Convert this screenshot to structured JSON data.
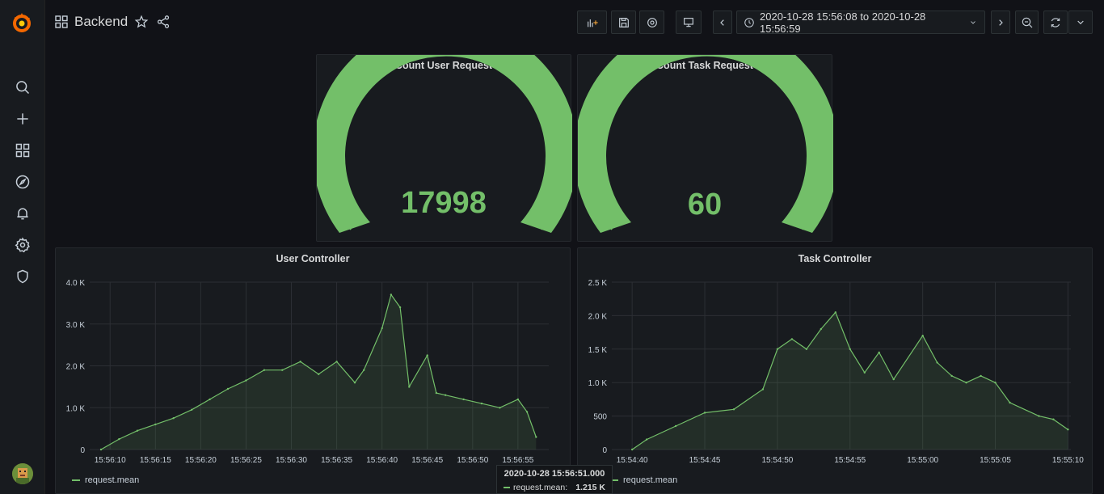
{
  "dashboard": {
    "title": "Backend"
  },
  "time_range": {
    "label": "2020-10-28 15:56:08 to 2020-10-28 15:56:59"
  },
  "icons": {
    "sidebar": [
      "search-icon",
      "plus-icon",
      "dashboards-icon",
      "explore-icon",
      "alerting-icon",
      "configuration-icon",
      "shield-icon"
    ],
    "toolbar": [
      "add-panel-icon",
      "save-icon",
      "settings-icon",
      "tv-mode-icon",
      "chevron-left-icon",
      "clock-icon",
      "chevron-right-icon",
      "zoom-out-icon",
      "refresh-icon",
      "chevron-down-icon"
    ]
  },
  "colors": {
    "accent": "#73bf69",
    "background": "#111217",
    "panel": "#181b1f",
    "logo": "#f46800"
  },
  "panels": {
    "gauge_user": {
      "title": "Count User Request",
      "value": "17998"
    },
    "gauge_task": {
      "title": "Count Task Request",
      "value": "60"
    },
    "user_controller": {
      "title": "User Controller",
      "legend": "request.mean"
    },
    "task_controller": {
      "title": "Task Controller",
      "legend": "request.mean"
    }
  },
  "tooltip": {
    "time": "2020-10-28 15:56:51.000",
    "series": "request.mean:",
    "value": "1.215 K"
  },
  "chart_data": [
    {
      "type": "area",
      "title": "User Controller",
      "x": [
        "15:56:09",
        "15:56:11",
        "15:56:13",
        "15:56:15",
        "15:56:17",
        "15:56:19",
        "15:56:21",
        "15:56:23",
        "15:56:25",
        "15:56:27",
        "15:56:29",
        "15:56:31",
        "15:56:33",
        "15:56:35",
        "15:56:37",
        "15:56:38",
        "15:56:40",
        "15:56:41",
        "15:56:42",
        "15:56:43",
        "15:56:45",
        "15:56:46",
        "15:56:47",
        "15:56:49",
        "15:56:51",
        "15:56:53",
        "15:56:55",
        "15:56:56",
        "15:56:57"
      ],
      "series": [
        {
          "name": "request.mean",
          "values": [
            0,
            250,
            450,
            600,
            750,
            950,
            1200,
            1450,
            1650,
            1900,
            1900,
            2100,
            1800,
            2100,
            1600,
            1900,
            2900,
            3700,
            3400,
            1500,
            2250,
            1350,
            1300,
            1200,
            1100,
            1000,
            1200,
            900,
            300
          ]
        }
      ],
      "x_ticks": [
        "15:56:10",
        "15:56:15",
        "15:56:20",
        "15:56:25",
        "15:56:30",
        "15:56:35",
        "15:56:40",
        "15:56:45",
        "15:56:50",
        "15:56:55"
      ],
      "y_ticks": [
        "0",
        "1.0 K",
        "2.0 K",
        "3.0 K",
        "4.0 K"
      ],
      "ylim": [
        0,
        4000
      ],
      "legend": "bottom-left",
      "grid": true
    },
    {
      "type": "area",
      "title": "Task Controller",
      "x": [
        "15:54:40",
        "15:54:41",
        "15:54:43",
        "15:54:45",
        "15:54:47",
        "15:54:49",
        "15:54:50",
        "15:54:51",
        "15:54:52",
        "15:54:53",
        "15:54:54",
        "15:54:55",
        "15:54:56",
        "15:54:57",
        "15:54:58",
        "15:55:00",
        "15:55:01",
        "15:55:02",
        "15:55:03",
        "15:55:04",
        "15:55:05",
        "15:55:06",
        "15:55:08",
        "15:55:09",
        "15:55:10"
      ],
      "series": [
        {
          "name": "request.mean",
          "values": [
            0,
            150,
            350,
            550,
            600,
            900,
            1500,
            1650,
            1500,
            1800,
            2050,
            1500,
            1150,
            1450,
            1050,
            1700,
            1300,
            1100,
            1000,
            1100,
            1000,
            700,
            500,
            450,
            300
          ]
        }
      ],
      "x_ticks": [
        "15:54:40",
        "15:54:45",
        "15:54:50",
        "15:54:55",
        "15:55:00",
        "15:55:05",
        "15:55:10"
      ],
      "y_ticks": [
        "0",
        "500",
        "1.0 K",
        "1.5 K",
        "2.0 K",
        "2.5 K"
      ],
      "ylim": [
        0,
        2500
      ],
      "legend": "bottom-left",
      "grid": true
    }
  ]
}
